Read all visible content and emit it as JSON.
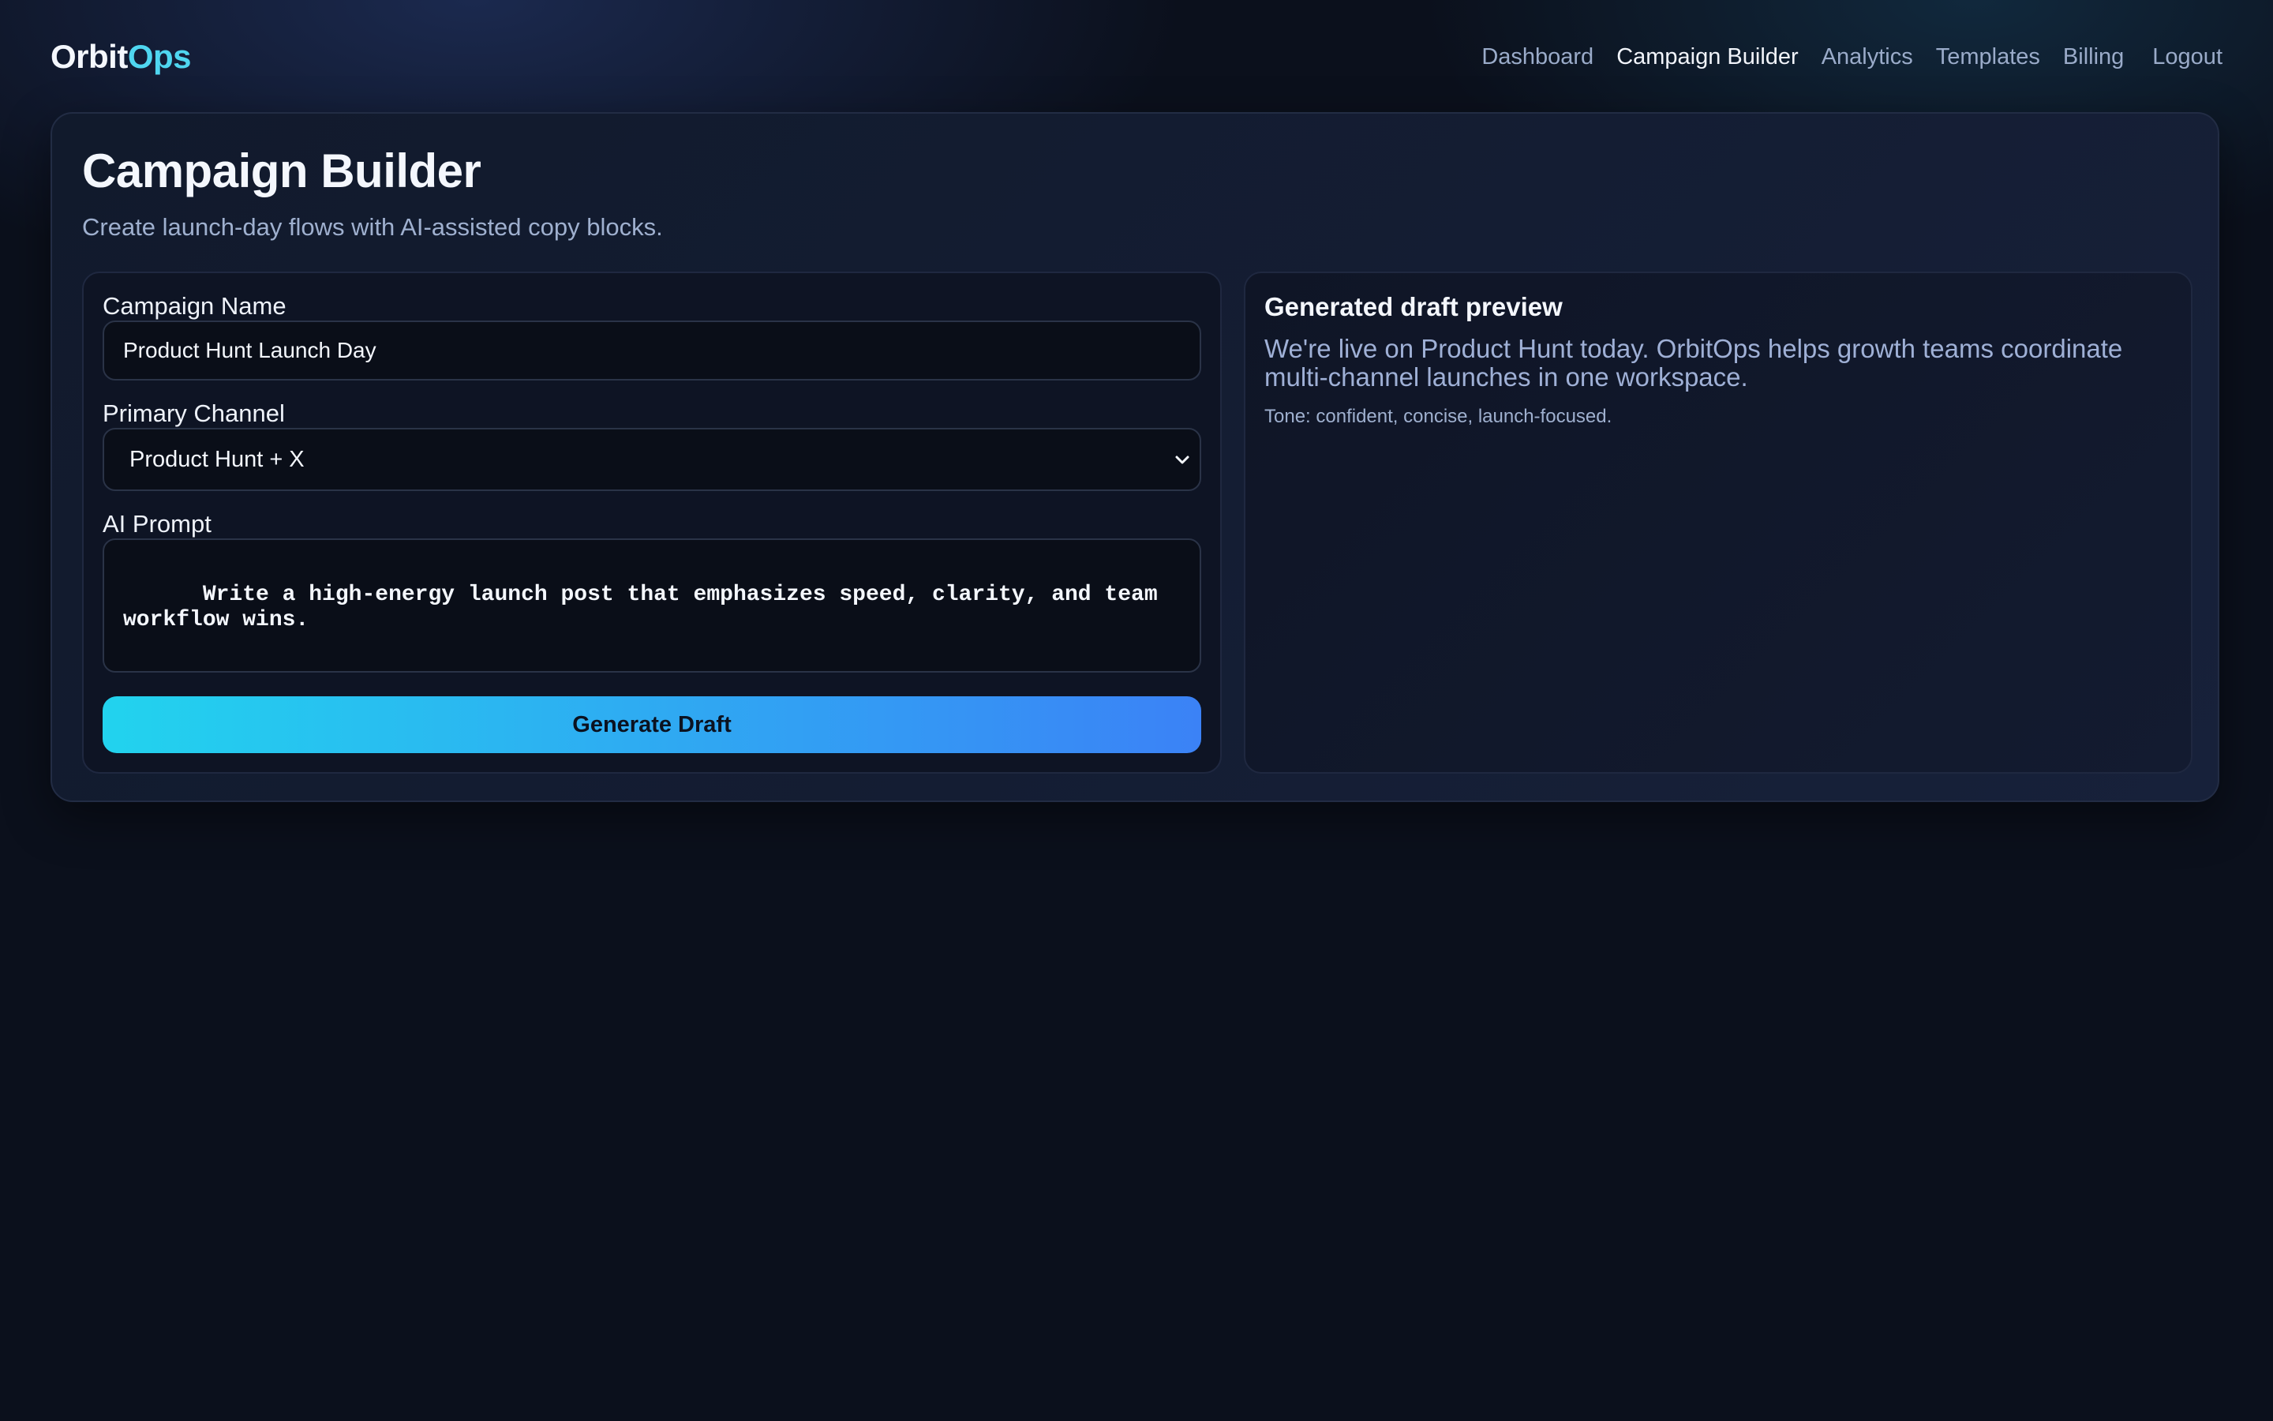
{
  "brand": {
    "name_primary": "Orbit",
    "name_accent": "Ops",
    "accent_color": "#4fd6f0"
  },
  "nav": {
    "items": [
      {
        "label": "Dashboard",
        "active": false
      },
      {
        "label": "Campaign Builder",
        "active": true
      },
      {
        "label": "Analytics",
        "active": false
      },
      {
        "label": "Templates",
        "active": false
      },
      {
        "label": "Billing",
        "active": false
      }
    ],
    "logout_label": "Logout"
  },
  "page": {
    "title": "Campaign Builder",
    "subtitle": "Create launch-day flows with AI-assisted copy blocks."
  },
  "form": {
    "campaign_name_label": "Campaign Name",
    "campaign_name_value": "Product Hunt Launch Day",
    "channel_label": "Primary Channel",
    "channel_selected": "Product Hunt + X",
    "prompt_label": "AI Prompt",
    "prompt_value": "Write a high-energy launch post that emphasizes speed, clarity, and team\nworkflow wins.",
    "generate_label": "Generate Draft",
    "button_gradient": [
      "#22d3ee",
      "#3b82f6"
    ]
  },
  "preview": {
    "title": "Generated draft preview",
    "body": "We're live on Product Hunt today. OrbitOps helps growth teams coordinate multi-channel launches in one workspace.",
    "tone": "Tone: confident, concise, launch-focused."
  }
}
